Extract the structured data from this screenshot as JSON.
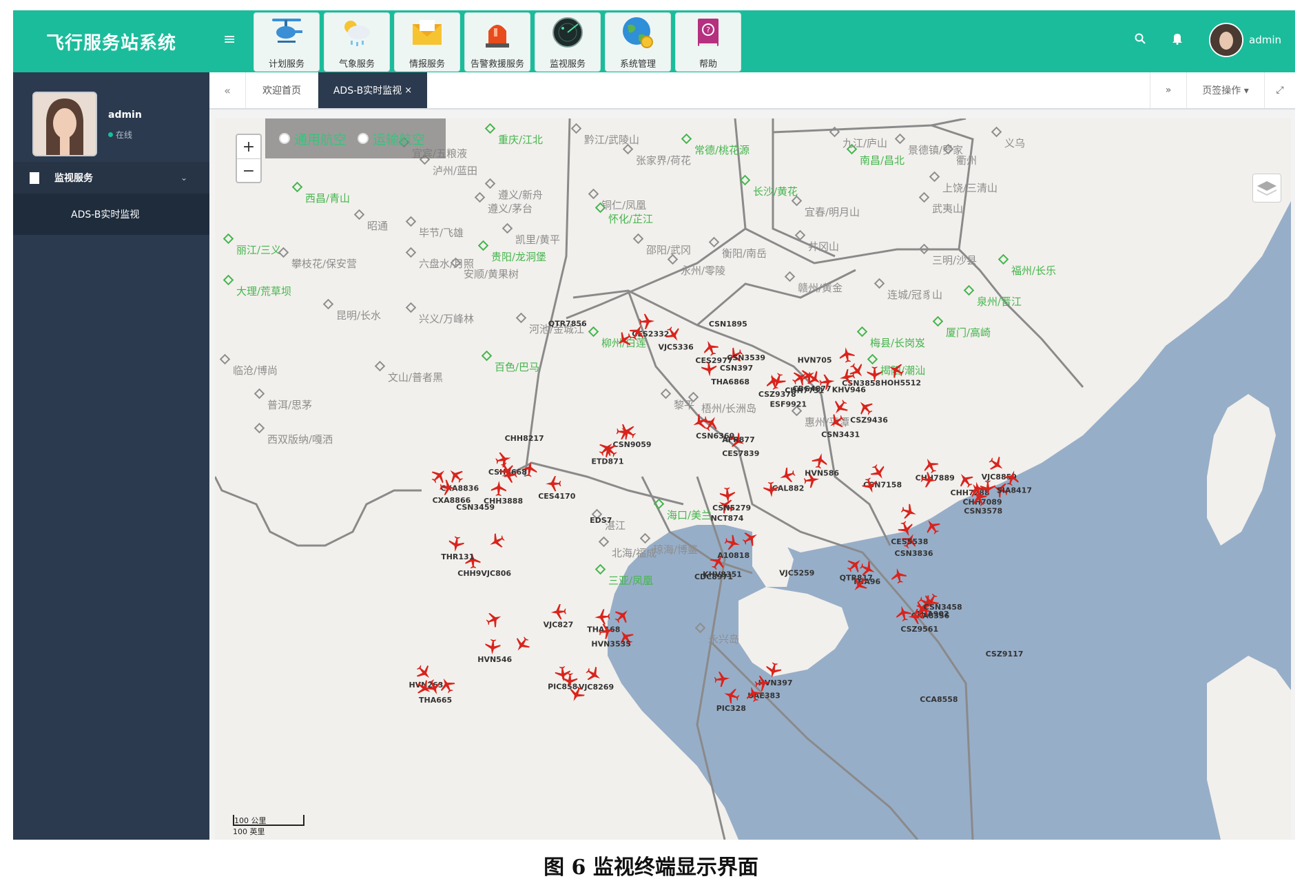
{
  "app": {
    "title": "飞行服务站系统"
  },
  "modules": [
    {
      "label": "计划服务",
      "icon": "helicopter-icon"
    },
    {
      "label": "气象服务",
      "icon": "weather-icon"
    },
    {
      "label": "情报服务",
      "icon": "envelope-icon"
    },
    {
      "label": "告警救援服务",
      "icon": "siren-icon"
    },
    {
      "label": "监视服务",
      "icon": "radar-icon"
    },
    {
      "label": "系统管理",
      "icon": "globe-gear-icon"
    },
    {
      "label": "帮助",
      "icon": "help-book-icon"
    }
  ],
  "header": {
    "user_name": "admin"
  },
  "sidebar": {
    "user_name": "admin",
    "status": "在线",
    "menu": {
      "label": "监视服务",
      "items": [
        {
          "label": "ADS-B实时监视"
        }
      ]
    }
  },
  "tabs": {
    "home": "欢迎首页",
    "active": "ADS-B实时监视",
    "close": "×",
    "actions": "页签操作 ▾"
  },
  "map": {
    "layers": {
      "general_aviation": "通用航空",
      "transport_aviation": "运输航空"
    },
    "zoom_in": "+",
    "zoom_out": "−",
    "scale_top": "100 公里",
    "scale_bottom": "100 英里",
    "airports": [
      "重庆/江北",
      "常德/桃花源",
      "长沙/黄花",
      "怀化/芷江",
      "贵阳/龙洞堡",
      "西昌/青山",
      "丽江/三义",
      "大理/荒草坝",
      "梅县/长岗岌",
      "揭阳/潮汕",
      "厦门/高崎",
      "泉州/晋江",
      "福州/长乐",
      "南昌/昌北",
      "百色/巴马",
      "柳州/白莲",
      "三亚/凤凰",
      "海口/美兰"
    ],
    "cities": [
      "宜宾/五粮液",
      "泸州/蓝田",
      "遵义/新舟",
      "遵义/茅台",
      "黔江/武陵山",
      "张家界/荷花",
      "铜仁/凤凰",
      "凯里/黄平",
      "毕节/飞雄",
      "六盘水/月照",
      "安顺/黄果树",
      "昭通",
      "攀枝花/保安营",
      "昆明/长水",
      "兴义/万峰林",
      "邵阳/武冈",
      "衡阳/南岳",
      "永州/零陵",
      "宜春/明月山",
      "井冈山",
      "赣州/黄金",
      "连城/冠豸山",
      "三明/沙县",
      "武夷山",
      "九江/庐山",
      "景德镇/罗家",
      "衢州",
      "上饶/三清山",
      "义乌",
      "河池/金城江",
      "文山/普者黑",
      "临沧/博尚",
      "普洱/思茅",
      "西双版纳/嘎洒",
      "黎平",
      "梧州/长洲岛",
      "永兴岛",
      "琼海/博鳌",
      "惠州/平潭",
      "湛江",
      "北海/福成"
    ],
    "flights": [
      "CES2332",
      "VJC5336",
      "CSN397",
      "CES2977",
      "CSZ9378",
      "CBG4877",
      "CHH7731",
      "CSZ9436",
      "CSN3431",
      "CSN6360",
      "CES7839",
      "CSN9059",
      "ETD871",
      "CES4170",
      "CSH8668",
      "CHH3888",
      "CXA8836",
      "CXA8866",
      "CAL882",
      "HVN586",
      "NCT874",
      "CSN5279",
      "A10818",
      "KHV8351",
      "CSN7158",
      "CHH7889",
      "CSN3836",
      "CES5538",
      "CHH7288",
      "CHH7089",
      "CSN3578",
      "HOH5512",
      "CSN3858",
      "KHV946",
      "CHH9VJC806",
      "THR131",
      "HVN546",
      "VJC827",
      "VJC8269",
      "PIC858",
      "THA168",
      "HVN3535",
      "HVN397",
      "UAE383",
      "PIC328",
      "QTR817",
      "THA96",
      "THA902",
      "CXA8356",
      "CSZ9561",
      "HVN263",
      "THA665",
      "VJC8859",
      "SIA8417",
      "THA6868",
      "AFR877",
      "EDS7",
      "ESF9921",
      "VJC5259",
      "CSN3539",
      "CSN3459",
      "CSN1895",
      "HVN705",
      "CHH8217",
      "CDC8971",
      "CSZ9117",
      "QTR7856",
      "CCA8558",
      "CSN3458"
    ]
  },
  "caption": "图 6  监视终端显示界面"
}
